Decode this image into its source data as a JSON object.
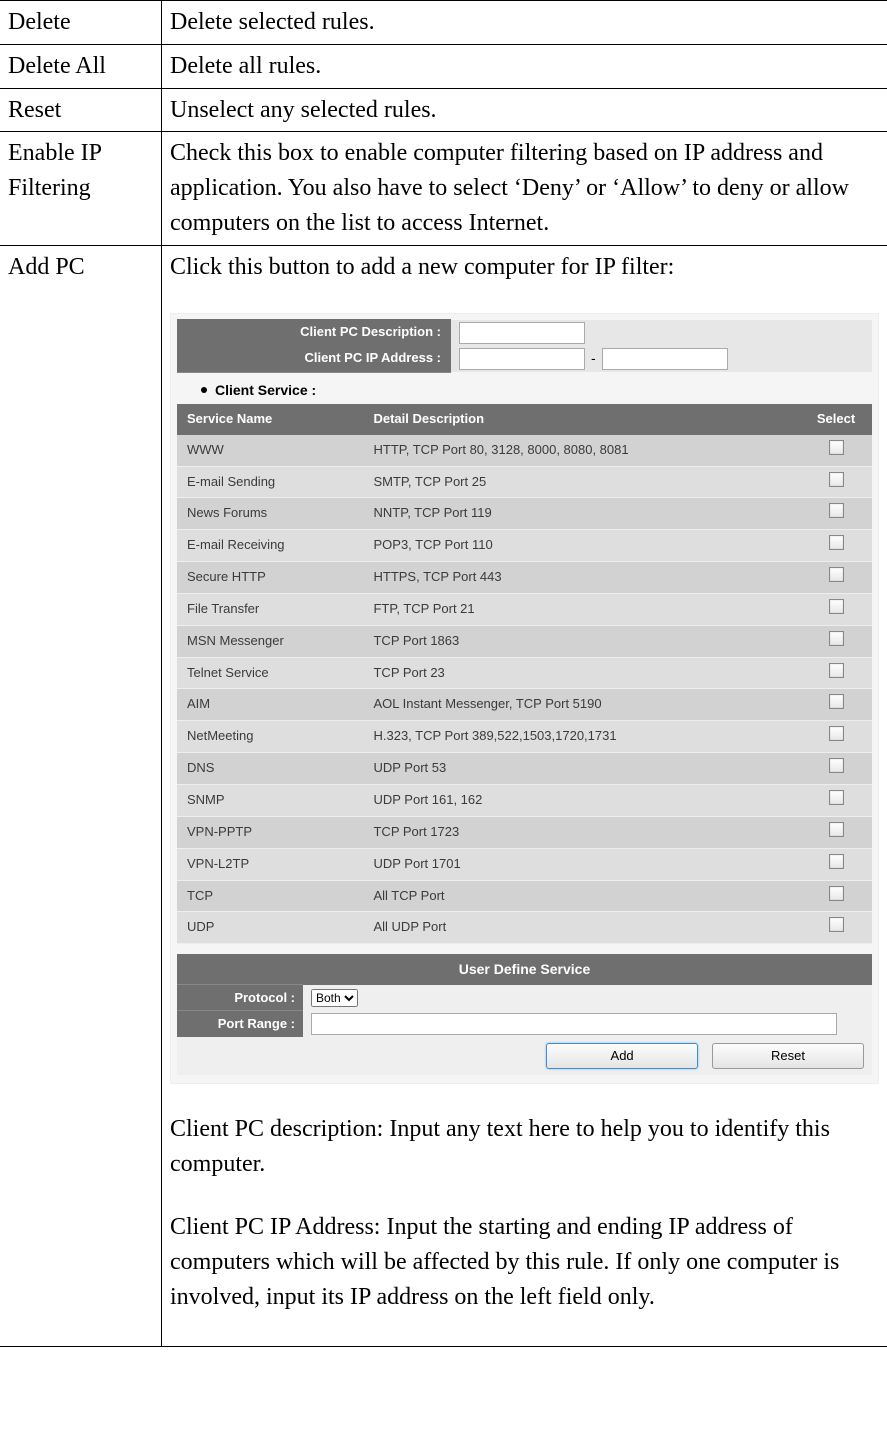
{
  "rows": {
    "delete": {
      "key": "Delete",
      "desc": "Delete selected rules."
    },
    "deleteAll": {
      "key": "Delete All",
      "desc": "Delete all rules."
    },
    "reset": {
      "key": "Reset",
      "desc": "Unselect any selected rules."
    },
    "enableIp": {
      "key": "Enable IP Filtering",
      "desc": "Check this box to enable computer filtering based on IP address and application. You also have to select ‘Deny’ or ‘Allow’ to deny or allow computers on the list to access Internet."
    },
    "addPc": {
      "key": "Add PC",
      "intro": "Click this button to add a new computer for IP filter:",
      "clientDescLabel": "Client PC Description :",
      "clientIpLabel": "Client PC IP Address :",
      "ipDash": "-",
      "clientServiceHeading": "Client Service :",
      "tableHeaders": {
        "name": "Service Name",
        "desc": "Detail Description",
        "select": "Select"
      },
      "services": [
        {
          "name": "WWW",
          "desc": "HTTP, TCP Port 80, 3128, 8000, 8080, 8081"
        },
        {
          "name": "E-mail Sending",
          "desc": "SMTP, TCP Port 25"
        },
        {
          "name": "News Forums",
          "desc": "NNTP, TCP Port 119"
        },
        {
          "name": "E-mail Receiving",
          "desc": "POP3, TCP Port 110"
        },
        {
          "name": "Secure HTTP",
          "desc": "HTTPS, TCP Port 443"
        },
        {
          "name": "File Transfer",
          "desc": "FTP, TCP Port 21"
        },
        {
          "name": "MSN Messenger",
          "desc": "TCP Port 1863"
        },
        {
          "name": "Telnet Service",
          "desc": "TCP Port 23"
        },
        {
          "name": "AIM",
          "desc": "AOL Instant Messenger, TCP Port 5190"
        },
        {
          "name": "NetMeeting",
          "desc": "H.323, TCP Port 389,522,1503,1720,1731"
        },
        {
          "name": "DNS",
          "desc": "UDP Port 53"
        },
        {
          "name": "SNMP",
          "desc": "UDP Port 161, 162"
        },
        {
          "name": "VPN-PPTP",
          "desc": "TCP Port 1723"
        },
        {
          "name": "VPN-L2TP",
          "desc": "UDP Port 1701"
        },
        {
          "name": "TCP",
          "desc": "All TCP Port"
        },
        {
          "name": "UDP",
          "desc": "All UDP Port"
        }
      ],
      "uds": {
        "header": "User Define Service",
        "protocolLabel": "Protocol :",
        "protocolValue": "Both",
        "portRangeLabel": "Port Range :",
        "addBtn": "Add",
        "resetBtn": "Reset"
      },
      "afterPara1": "Client PC description: Input any text here to help you to identify this computer.",
      "afterPara2": "Client PC IP Address: Input the starting and ending IP address of computers which will be affected by this rule. If only one computer is involved, input its IP address on the left field only."
    }
  }
}
